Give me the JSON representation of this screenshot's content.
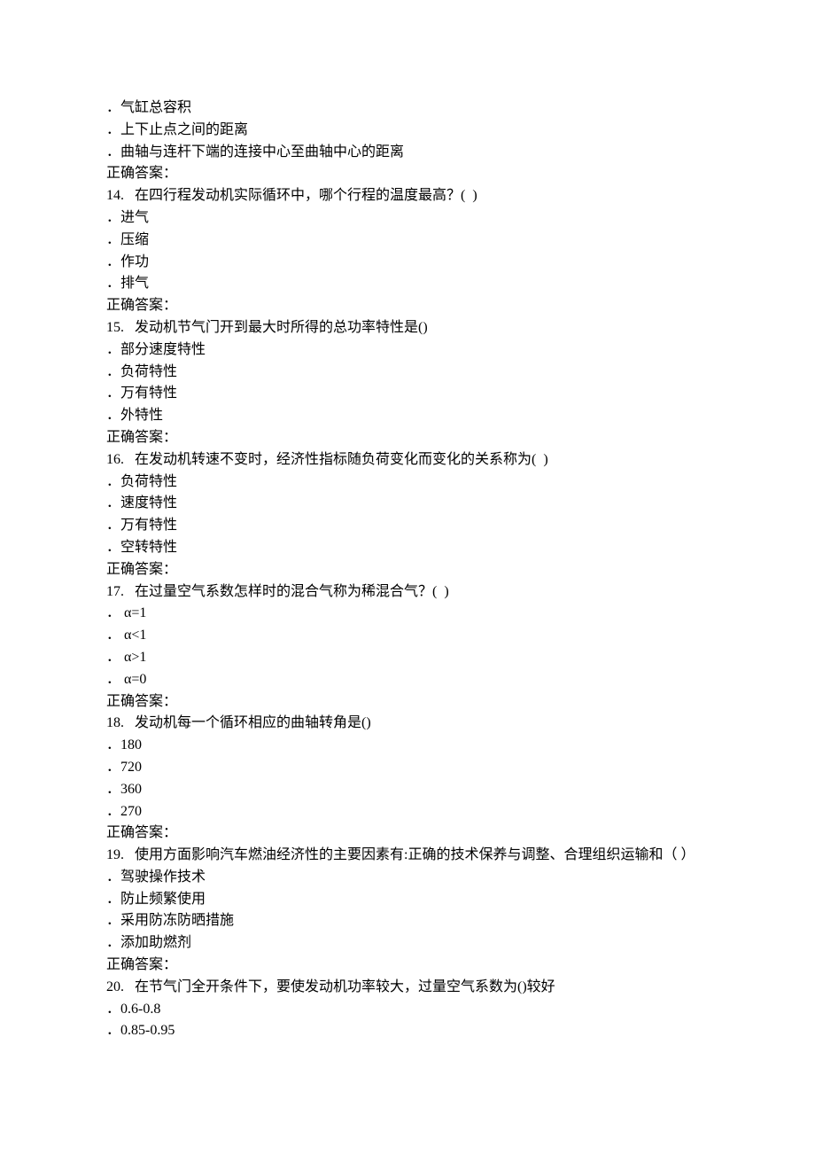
{
  "questions": [
    {
      "number": "",
      "stem": "",
      "options": [
        "气缸总容积",
        "上下止点之间的距离",
        "曲轴与连杆下端的连接中心至曲轴中心的距离"
      ],
      "answer_label": "正确答案："
    },
    {
      "number": "14.",
      "stem": "在四行程发动机实际循环中，哪个行程的温度最高？(  )",
      "options": [
        "进气",
        "压缩",
        "作功",
        "排气"
      ],
      "answer_label": "正确答案："
    },
    {
      "number": "15.",
      "stem": "发动机节气门开到最大时所得的总功率特性是()",
      "options": [
        "部分速度特性",
        "负荷特性",
        "万有特性",
        "外特性"
      ],
      "answer_label": "正确答案："
    },
    {
      "number": "16.",
      "stem": "在发动机转速不变时，经济性指标随负荷变化而变化的关系称为(  )",
      "options": [
        "负荷特性",
        "速度特性",
        "万有特性",
        "空转特性"
      ],
      "answer_label": "正确答案："
    },
    {
      "number": "17.",
      "stem": "在过量空气系数怎样时的混合气称为稀混合气？(  )",
      "options": [
        " α=1",
        " α<1",
        " α>1",
        " α=0"
      ],
      "answer_label": "正确答案："
    },
    {
      "number": "18.",
      "stem": "发动机每一个循环相应的曲轴转角是()",
      "options": [
        "180",
        "720",
        "360",
        "270"
      ],
      "answer_label": "正确答案："
    },
    {
      "number": "19.",
      "stem": "使用方面影响汽车燃油经济性的主要因素有:正确的技术保养与调整、合理组织运输和（ ）",
      "options": [
        "驾驶操作技术",
        "防止频繁使用",
        "采用防冻防晒措施",
        "添加助燃剂"
      ],
      "answer_label": "正确答案："
    },
    {
      "number": "20.",
      "stem": "在节气门全开条件下，要使发动机功率较大，过量空气系数为()较好",
      "options": [
        "0.6-0.8",
        "0.85-0.95"
      ],
      "answer_label": ""
    }
  ]
}
